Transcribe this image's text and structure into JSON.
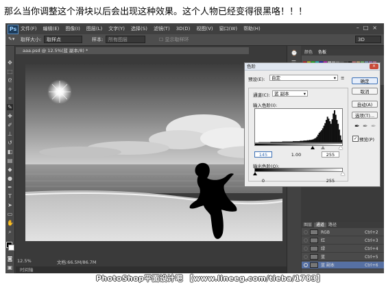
{
  "caption": "那么当你调整这个滑块以后会出现这种效果。这个人物已经变得很黑咯！！！",
  "app": {
    "logo": "Ps",
    "menu": [
      "文件(F)",
      "编辑(E)",
      "图像(I)",
      "图层(L)",
      "文字(Y)",
      "选择(S)",
      "滤镜(T)",
      "3D(D)",
      "视图(V)",
      "窗口(W)",
      "帮助(H)"
    ],
    "window_controls": "–□×",
    "workspace": "3D"
  },
  "options_bar": {
    "sample_size_label": "取样大小:",
    "sample_size_value": "取样点",
    "sample_label": "样本:",
    "sample_value": "所有图层",
    "show_ring_label": "显示取样环"
  },
  "document": {
    "tab_title": "aaa.psd @ 12.5%(蓝 副本/8) *",
    "zoom": "12.5%",
    "doc_info": "文档:66.5M/86.7M",
    "timeline_label": "时间轴"
  },
  "swatches": {
    "tabs": [
      "颜色",
      "色板"
    ],
    "colors": [
      "#ff0000",
      "#ffff00",
      "#00ff00",
      "#00ffff",
      "#0000ff",
      "#ff00ff",
      "#ffffff",
      "#c8c8c8",
      "#969696",
      "#646464",
      "#323232",
      "#000000",
      "#ff8080",
      "#ffd080",
      "#80ff80",
      "#80c0ff",
      "#c080ff",
      "#ff80c0"
    ]
  },
  "channels": {
    "tabs": [
      "图层",
      "通道",
      "路径"
    ],
    "active_tab_index": 1,
    "rows": [
      {
        "name": "RGB",
        "shortcut": "Ctrl+2"
      },
      {
        "name": "红",
        "shortcut": "Ctrl+3"
      },
      {
        "name": "绿",
        "shortcut": "Ctrl+4"
      },
      {
        "name": "蓝",
        "shortcut": "Ctrl+5"
      },
      {
        "name": "蓝 副本",
        "shortcut": "Ctrl+6"
      }
    ],
    "selected_index": 4
  },
  "levels_dialog": {
    "title": "色阶",
    "close": "×",
    "preset_label": "预设(E):",
    "preset_value": "自定",
    "channel_label": "通道(C):",
    "channel_value": "蓝 副本",
    "input_label": "输入色阶(I):",
    "input_values": [
      "145",
      "1.00",
      "255"
    ],
    "output_label": "输出色阶(O):",
    "output_values": [
      "0",
      "255"
    ],
    "buttons": {
      "ok": "确定",
      "cancel": "取消",
      "auto": "自动(A)",
      "options": "选项(T)..."
    },
    "preview_label": "预览(P)",
    "preview_checked": true,
    "histogram": [
      0,
      0,
      0,
      1,
      1,
      1,
      1,
      1,
      1,
      1,
      1,
      1,
      1,
      2,
      2,
      2,
      2,
      2,
      2,
      2,
      2,
      2,
      2,
      3,
      3,
      3,
      3,
      3,
      3,
      3,
      3,
      3,
      4,
      4,
      4,
      4,
      4,
      4,
      5,
      5,
      5,
      6,
      6,
      6,
      7,
      7,
      8,
      8,
      9,
      10,
      12,
      14,
      18,
      24,
      30,
      34,
      38,
      44,
      52,
      60,
      70,
      80,
      74,
      66,
      58,
      72,
      90,
      100,
      86,
      70,
      58,
      40,
      22,
      8
    ]
  },
  "watermark": "PhotoShop平面设计吧 【www.lineeg.com/tieba/1783】"
}
